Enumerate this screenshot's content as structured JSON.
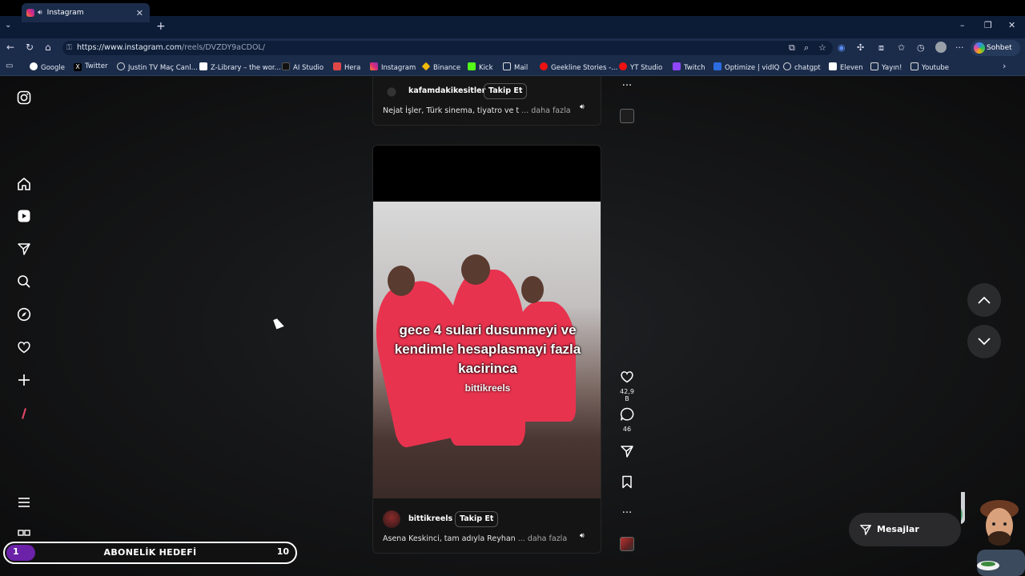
{
  "browser": {
    "tab_title": "Instagram",
    "new_tab": "+",
    "url_host": "https://www.instagram.com",
    "url_path": "/reels/DVZDY9aCDOL/",
    "copilot_label": "Sohbet et",
    "bookmarks": [
      "Google",
      "Twitter",
      "Justin TV Maç Canl...",
      "Z-Library – the wor...",
      "AI Studio",
      "Hera",
      "Instagram",
      "Binance",
      "Kick",
      "Mail",
      "Geekline Stories -...",
      "YT Studio",
      "Twitch",
      "Optimize | vidIQ",
      "chatgpt",
      "Eleven",
      "Yayın!",
      "Youtube"
    ]
  },
  "reel_prev": {
    "username": "kafamdakikesitler",
    "follow_label": "Takip Et",
    "description": "Nejat İşler, Türk sinema, tiyatro ve t",
    "more": "... daha fazla"
  },
  "reel": {
    "overlay_text": "gece 4 sulari dusunmeyi ve kendimle hesaplasmayi fazla kacirinca",
    "watermark": "bittikreels",
    "username": "bittikreels",
    "follow_label": "Takip Et",
    "description": "Asena Keskinci, tam adıyla Reyhan",
    "more": "... daha fazla",
    "likes": "42,9 B",
    "comments": "46"
  },
  "messages_label": "Mesajlar",
  "overlay_goal": {
    "current": "1",
    "title": "ABONELİK HEDEFİ",
    "target": "10",
    "progress_fraction": 0.1
  },
  "colors": {
    "chrome_dark": "#0c1c36",
    "chrome": "#1b2c4b",
    "like_red": "#e8334e",
    "goal_purple": "#6b21a8"
  }
}
